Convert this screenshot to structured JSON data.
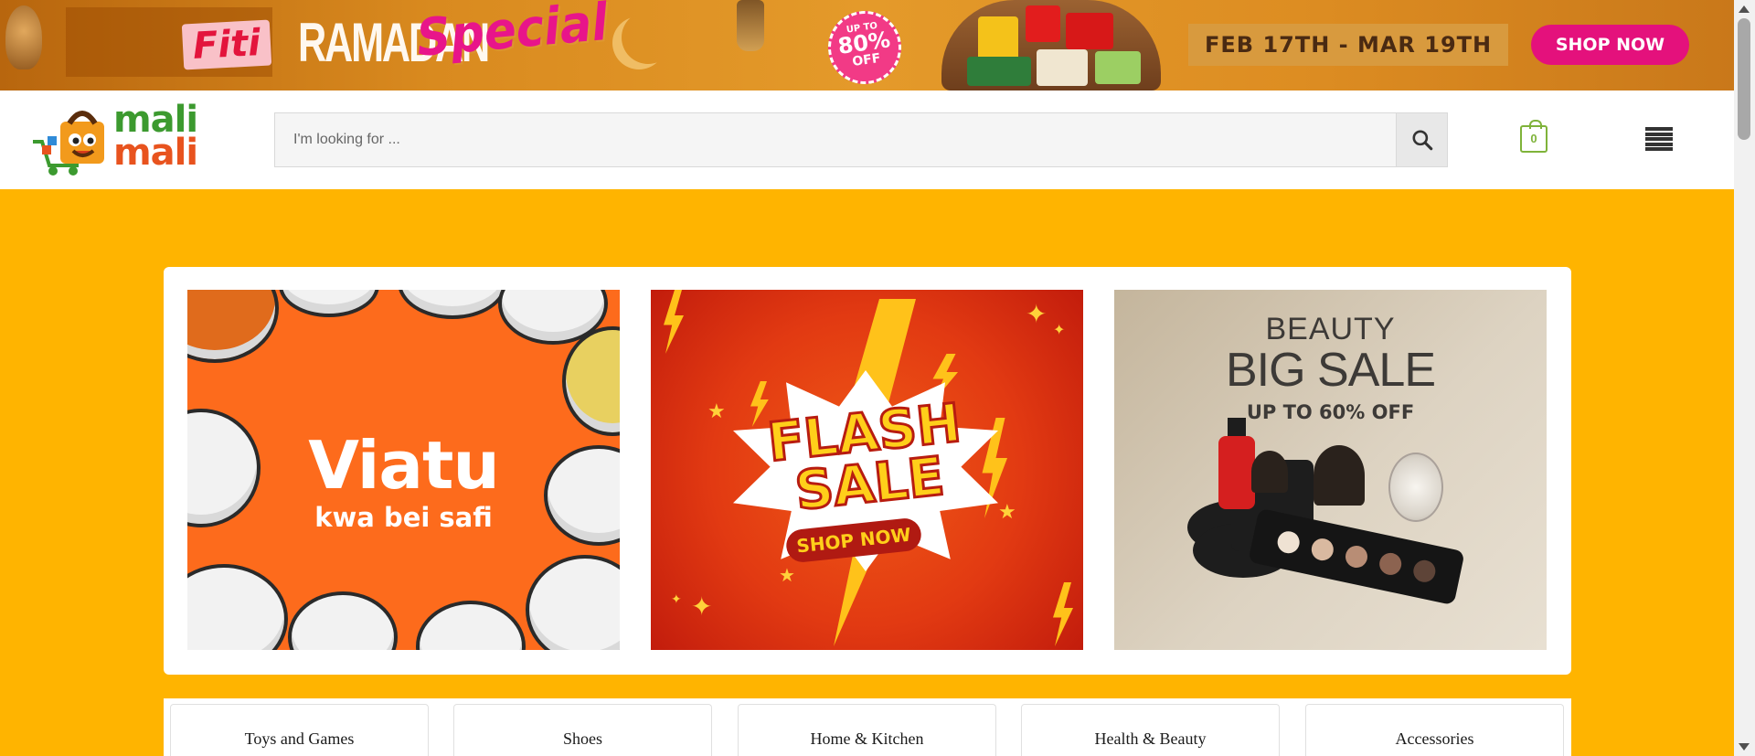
{
  "promo_banner": {
    "brand": "Fiti",
    "word1": "RAMADAN",
    "word2": "Special",
    "offer_prefix": "UP TO",
    "offer_value": "80%",
    "offer_suffix": "OFF",
    "dates": "FEB 17TH - MAR 19TH",
    "cta": "SHOP NOW",
    "cta_color": "#e4117c"
  },
  "header": {
    "logo_line1": "mali",
    "logo_line2": "mali",
    "search_placeholder": "I'm looking for ...",
    "cart_count": "0",
    "accent_color": "#7fb33a"
  },
  "promo_cards": [
    {
      "title": "Viatu",
      "subtitle": "kwa bei safi"
    },
    {
      "title_line1": "FLASH",
      "title_line2": "SALE",
      "cta": "SHOP NOW"
    },
    {
      "line1": "BEAUTY",
      "line2": "BIG SALE",
      "line3": "UP TO 60% OFF"
    }
  ],
  "categories": [
    {
      "label": "Toys and Games"
    },
    {
      "label": "Shoes"
    },
    {
      "label": "Home & Kitchen"
    },
    {
      "label": "Health & Beauty"
    },
    {
      "label": "Accessories"
    }
  ],
  "theme": {
    "background": "#ffb400"
  }
}
